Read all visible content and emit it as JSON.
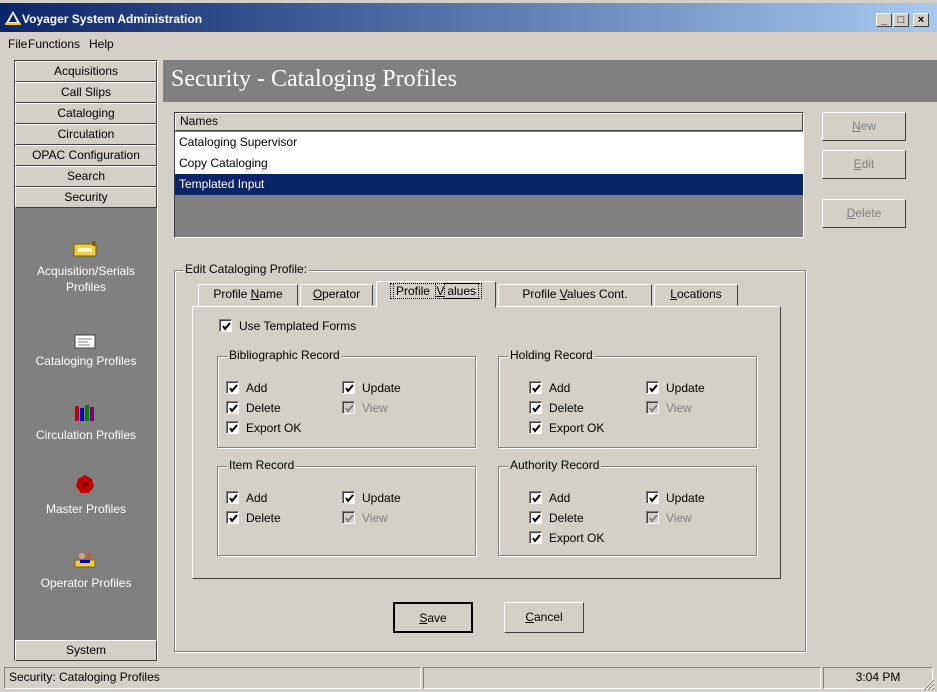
{
  "window": {
    "title": "Voyager System Administration",
    "buttons": {
      "minimize": "_",
      "maximize": "□",
      "close": "×"
    }
  },
  "menu": {
    "items": [
      "File",
      "Functions",
      "Help"
    ]
  },
  "sidebar": {
    "modules": [
      "Acquisitions",
      "Call Slips",
      "Cataloging",
      "Circulation",
      "OPAC Configuration",
      "Search",
      "Security"
    ],
    "items": [
      {
        "label_line1": "Acquisition/Serials",
        "label_line2": "Profiles",
        "icon": "acquisition-profile-icon"
      },
      {
        "label_line1": "Cataloging Profiles",
        "label_line2": "",
        "icon": "cataloging-profile-icon"
      },
      {
        "label_line1": "Circulation Profiles",
        "label_line2": "",
        "icon": "circulation-profile-icon"
      },
      {
        "label_line1": "Master Profiles",
        "label_line2": "",
        "icon": "master-profile-icon"
      },
      {
        "label_line1": "Operator Profiles",
        "label_line2": "",
        "icon": "operator-profile-icon"
      }
    ],
    "bottom_button": "System"
  },
  "header": {
    "title": "Security - Cataloging Profiles"
  },
  "names_list": {
    "column_header": "Names",
    "rows": [
      "Cataloging Supervisor",
      "Copy Cataloging",
      "Templated Input"
    ],
    "selected": "Templated Input"
  },
  "actions": {
    "new": {
      "pre": "",
      "key": "N",
      "post": "ew"
    },
    "edit": {
      "pre": "",
      "key": "E",
      "post": "dit"
    },
    "delete": {
      "pre": "",
      "key": "D",
      "post": "elete"
    }
  },
  "edit_group": {
    "label": "Edit  Cataloging Profile:"
  },
  "tabs": [
    {
      "pre": "Profile ",
      "key": "N",
      "post": "ame"
    },
    {
      "pre": "",
      "key": "O",
      "post": "perator"
    },
    {
      "pre": "Profile ",
      "key": "V",
      "post": "alues"
    },
    {
      "pre": "Profile ",
      "key": "V",
      "post": "alues Cont."
    },
    {
      "pre": "",
      "key": "L",
      "post": "ocations"
    }
  ],
  "active_tab": "Profile Values",
  "use_templated_forms": {
    "label": "Use Templated Forms",
    "checked": true
  },
  "groups": {
    "bibliographic": {
      "title": "Bibliographic Record",
      "add": "Add",
      "delete": "Delete",
      "export": "Export OK",
      "update": "Update",
      "view": "View"
    },
    "holding": {
      "title": "Holding Record",
      "add": "Add",
      "delete": "Delete",
      "export": "Export OK",
      "update": "Update",
      "view": "View"
    },
    "item": {
      "title": "Item Record",
      "add": "Add",
      "delete": "Delete",
      "update": "Update",
      "view": "View"
    },
    "authority": {
      "title": "Authority Record",
      "add": "Add",
      "delete": "Delete",
      "export": "Export OK",
      "update": "Update",
      "view": "View"
    }
  },
  "dialog_buttons": {
    "save": {
      "pre": "",
      "key": "S",
      "post": "ave"
    },
    "cancel": {
      "pre": "",
      "key": "C",
      "post": "ancel"
    }
  },
  "status": {
    "text": "Security:  Cataloging Profiles",
    "time": "3:04 PM"
  }
}
